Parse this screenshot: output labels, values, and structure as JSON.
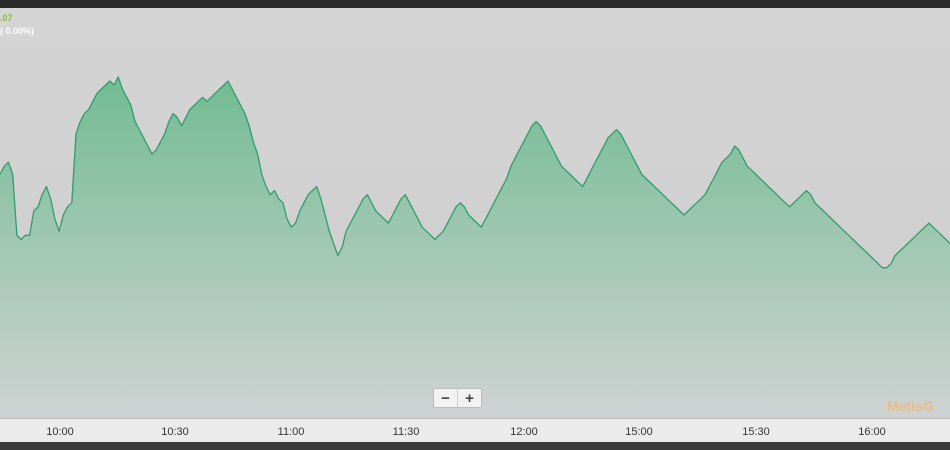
{
  "readout": {
    "price": ".07",
    "change": "( 0.00%)"
  },
  "zoom": {
    "minus_label": "−",
    "plus_label": "+"
  },
  "watermark": "MetisG",
  "colors": {
    "line": "#2e9e6a",
    "fill_top": "#6cba8f",
    "fill_bottom": "#cfd3d3",
    "accent_price": "#8bbf3a"
  },
  "chart_data": {
    "type": "area",
    "title": "",
    "xlabel": "",
    "ylabel": "",
    "grid": false,
    "x_ticks": [
      "10:00",
      "10:30",
      "11:00",
      "11:30",
      "12:00",
      "15:00",
      "15:30",
      "16:00"
    ],
    "ylim": [
      0,
      100
    ],
    "y": [
      60,
      62,
      63,
      60,
      45,
      44,
      45,
      45,
      51,
      52,
      55,
      57,
      54,
      49,
      46,
      50,
      52,
      53,
      70,
      73,
      75,
      76,
      78,
      80,
      81,
      82,
      83,
      82,
      84,
      81,
      79,
      77,
      73,
      71,
      69,
      67,
      65,
      66,
      68,
      70,
      73,
      75,
      74,
      72,
      74,
      76,
      77,
      78,
      79,
      78,
      79,
      80,
      81,
      82,
      83,
      81,
      79,
      77,
      75,
      72,
      68,
      65,
      60,
      57,
      55,
      56,
      54,
      53,
      49,
      47,
      48,
      51,
      53,
      55,
      56,
      57,
      54,
      50,
      46,
      43,
      40,
      42,
      46,
      48,
      50,
      52,
      54,
      55,
      53,
      51,
      50,
      49,
      48,
      50,
      52,
      54,
      55,
      53,
      51,
      49,
      47,
      46,
      45,
      44,
      45,
      46,
      48,
      50,
      52,
      53,
      52,
      50,
      49,
      48,
      47,
      49,
      51,
      53,
      55,
      57,
      59,
      62,
      64,
      66,
      68,
      70,
      72,
      73,
      72,
      70,
      68,
      66,
      64,
      62,
      61,
      60,
      59,
      58,
      57,
      59,
      61,
      63,
      65,
      67,
      69,
      70,
      71,
      70,
      68,
      66,
      64,
      62,
      60,
      59,
      58,
      57,
      56,
      55,
      54,
      53,
      52,
      51,
      50,
      51,
      52,
      53,
      54,
      55,
      57,
      59,
      61,
      63,
      64,
      65,
      67,
      66,
      64,
      62,
      61,
      60,
      59,
      58,
      57,
      56,
      55,
      54,
      53,
      52,
      53,
      54,
      55,
      56,
      55,
      53,
      52,
      51,
      50,
      49,
      48,
      47,
      46,
      45,
      44,
      43,
      42,
      41,
      40,
      39,
      38,
      37,
      37,
      38,
      40,
      41,
      42,
      43,
      44,
      45,
      46,
      47,
      48,
      47,
      46,
      45,
      44,
      43
    ]
  }
}
